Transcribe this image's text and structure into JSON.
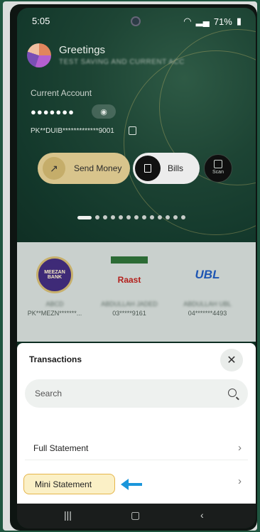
{
  "status_bar": {
    "time": "5:05",
    "battery": "71%"
  },
  "account": {
    "greeting": "Greetings",
    "subtitle": "TEST SAVING AND CURRENT ACC",
    "type_label": "Current Account",
    "masked_balance": "●●●●●●●",
    "iban": "PK**DUIB*************9001"
  },
  "actions": {
    "send_money": "Send Money",
    "bills": "Bills",
    "scan": "Scan"
  },
  "carousel": {
    "total": 13,
    "active_index": 0
  },
  "payees": [
    {
      "logo_text": "MEEZAN BANK",
      "name": "ABCD",
      "account": "PK**MEZN*******..."
    },
    {
      "logo_text": "Raast",
      "name": "ABDULLAH JADED",
      "account": "03*****9161"
    },
    {
      "logo_text": "UBL",
      "name": "ABDULLAH UBL",
      "account": "04*******4493"
    }
  ],
  "transactions": {
    "title": "Transactions",
    "search_placeholder": "Search",
    "items": [
      "Full Statement",
      "Mini Statement"
    ]
  },
  "colors": {
    "banner": "#1d4434",
    "gold": "#d8c48c",
    "highlight": "#fbf0c6",
    "arrow": "#1b96db"
  }
}
